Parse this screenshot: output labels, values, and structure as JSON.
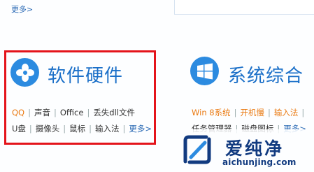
{
  "top": {
    "more_label": "更多>"
  },
  "hardware": {
    "title": "软件硬件",
    "row1": [
      "QQ",
      "声音",
      "Office",
      "丢失dll文件"
    ],
    "row2": [
      "U盘",
      "摄像头",
      "鼠标",
      "输入法"
    ],
    "more_label": "更多>"
  },
  "system": {
    "title": "系统综合",
    "row1": [
      "Win 8系统",
      "开机慢",
      "输入法"
    ],
    "row2": [
      "任务管理器",
      "磁盘图标"
    ],
    "more_label": "更多>"
  },
  "watermark": {
    "name": "爱纯净",
    "url": "aichunjing.com"
  },
  "colors": {
    "accent": "#1a6fc8",
    "highlight_box": "#e4141b",
    "hot_link": "#ea7a12"
  }
}
